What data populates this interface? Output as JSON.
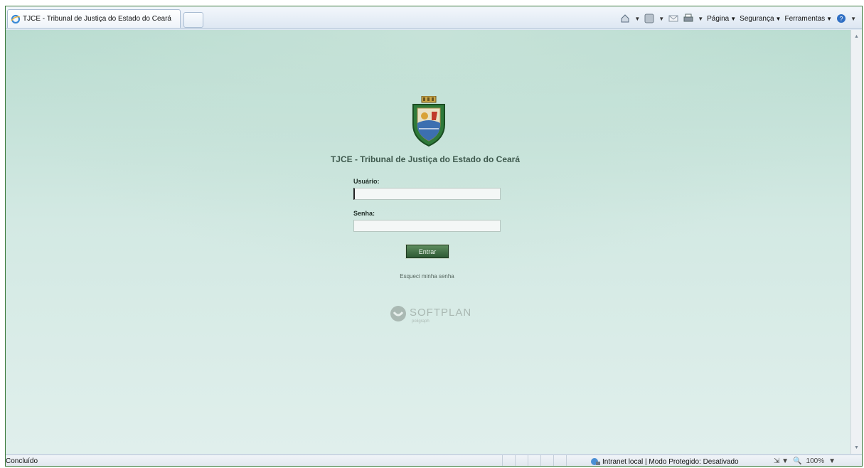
{
  "tab": {
    "title": "TJCE - Tribunal de Justiça do Estado do Ceará"
  },
  "commandbar": {
    "icons": [
      "home-icon",
      "feeds-icon",
      "mail-icon",
      "print-icon",
      "help-icon"
    ],
    "menus": [
      {
        "label": "Página"
      },
      {
        "label": "Segurança"
      },
      {
        "label": "Ferramentas"
      }
    ]
  },
  "page": {
    "title": "TJCE - Tribunal de Justiça do Estado do Ceará",
    "login": {
      "user_label": "Usuário:",
      "user_value": "",
      "password_label": "Senha:",
      "password_value": "",
      "submit_label": "Entrar",
      "forgot_label": "Esqueci minha senha"
    },
    "vendor": {
      "name": "SOFTPLAN",
      "sub": "poligraph"
    }
  },
  "statusbar": {
    "status": "Concluído",
    "zone": "Intranet local | Modo Protegido: Desativado",
    "zoom": "100%"
  },
  "colors": {
    "accent_green": "#2e5a34",
    "content_bg": "#d3e9e3"
  }
}
